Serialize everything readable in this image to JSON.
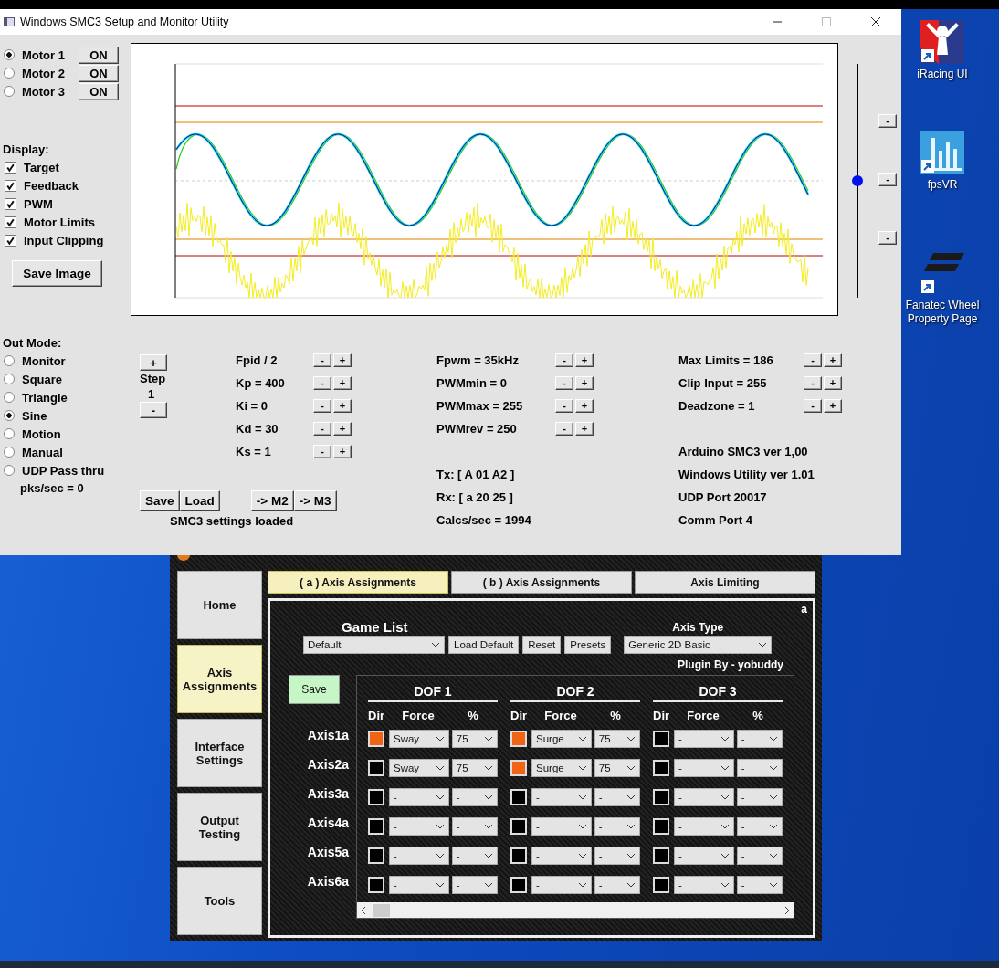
{
  "smc3_window": {
    "title": "Windows SMC3 Setup and Monitor Utility",
    "motors": [
      {
        "label": "Motor 1",
        "selected": true,
        "button": "ON"
      },
      {
        "label": "Motor 2",
        "selected": false,
        "button": "ON"
      },
      {
        "label": "Motor 3",
        "selected": false,
        "button": "ON"
      }
    ],
    "display": {
      "label": "Display:",
      "options": [
        {
          "label": "Target",
          "checked": true
        },
        {
          "label": "Feedback",
          "checked": true
        },
        {
          "label": "PWM",
          "checked": true
        },
        {
          "label": "Motor Limits",
          "checked": true
        },
        {
          "label": "Input Clipping",
          "checked": true
        }
      ]
    },
    "save_image": "Save Image",
    "graph_slider": {
      "level": 0.5
    },
    "side_buttons": [
      "-",
      "-",
      "-"
    ],
    "out_mode": {
      "label": "Out Mode:",
      "options": [
        {
          "label": "Monitor",
          "selected": false
        },
        {
          "label": "Square",
          "selected": false
        },
        {
          "label": "Triangle",
          "selected": false
        },
        {
          "label": "Sine",
          "selected": true
        },
        {
          "label": "Motion",
          "selected": false
        },
        {
          "label": "Manual",
          "selected": false
        },
        {
          "label": "UDP Pass thru",
          "selected": false
        }
      ],
      "rate": "pks/sec = 0"
    },
    "step": {
      "plus": "+",
      "label": "Step",
      "value": "1",
      "minus": "-"
    },
    "pid": [
      {
        "label": "Fpid / 2",
        "minus": "-",
        "plus": "+"
      },
      {
        "label": "Kp = 400",
        "minus": "-",
        "plus": "+"
      },
      {
        "label": "Ki = 0",
        "minus": "-",
        "plus": "+"
      },
      {
        "label": "Kd = 30",
        "minus": "-",
        "plus": "+"
      },
      {
        "label": "Ks = 1",
        "minus": "-",
        "plus": "+"
      }
    ],
    "pwm": [
      {
        "label": "Fpwm = 35kHz",
        "minus": "-",
        "plus": "+"
      },
      {
        "label": "PWMmin = 0",
        "minus": "-",
        "plus": "+"
      },
      {
        "label": "PWMmax = 255",
        "minus": "-",
        "plus": "+"
      },
      {
        "label": "PWMrev = 250",
        "minus": "-",
        "plus": "+"
      }
    ],
    "comms": [
      "Tx: [ A 01 A2 ]",
      "Rx: [ a 20 25 ]",
      "Calcs/sec = 1994"
    ],
    "limits": [
      {
        "label": "Max Limits = 186",
        "minus": "-",
        "plus": "+"
      },
      {
        "label": "Clip Input = 255",
        "minus": "-",
        "plus": "+"
      },
      {
        "label": "Deadzone = 1",
        "minus": "-",
        "plus": "+"
      }
    ],
    "info": [
      "Arduino SMC3 ver 1,00",
      "Windows Utility ver 1.01",
      "UDP Port 20017",
      "Comm Port 4"
    ],
    "file_buttons": [
      "Save",
      "Load"
    ],
    "copy_buttons": [
      "-> M2",
      "-> M3"
    ],
    "status": "SMC3 settings loaded"
  },
  "simtools_window": {
    "sidebar": [
      {
        "label": "Home",
        "selected": false
      },
      {
        "label": "Axis Assignments",
        "selected": true
      },
      {
        "label": "Interface Settings",
        "selected": false
      },
      {
        "label": "Output Testing",
        "selected": false
      },
      {
        "label": "Tools",
        "selected": false
      }
    ],
    "tabs": [
      {
        "label": "( a ) Axis Assignments",
        "selected": true
      },
      {
        "label": "( b ) Axis Assignments",
        "selected": false
      },
      {
        "label": "Axis Limiting",
        "selected": false
      }
    ],
    "corner_label": "a",
    "game_list": {
      "label": "Game List",
      "value": "Default",
      "buttons": [
        "Load Default",
        "Reset",
        "Presets"
      ]
    },
    "axis_type": {
      "label": "Axis Type",
      "value": "Generic 2D Basic"
    },
    "plugin_by": "Plugin By - yobuddy",
    "save": "Save",
    "dofs": [
      {
        "title": "DOF 1",
        "dir": "Dir",
        "force": "Force",
        "percent": "%"
      },
      {
        "title": "DOF 2",
        "dir": "Dir",
        "force": "Force",
        "percent": "%"
      },
      {
        "title": "DOF 3",
        "dir": "Dir",
        "force": "Force",
        "percent": "%"
      }
    ],
    "axes": [
      {
        "label": "Axis1a",
        "cells": [
          {
            "dir": true,
            "force": "Sway",
            "percent": "75"
          },
          {
            "dir": true,
            "force": "Surge",
            "percent": "75"
          },
          {
            "dir": false,
            "force": "-",
            "percent": "-"
          }
        ]
      },
      {
        "label": "Axis2a",
        "cells": [
          {
            "dir": false,
            "force": "Sway",
            "percent": "75"
          },
          {
            "dir": true,
            "force": "Surge",
            "percent": "75"
          },
          {
            "dir": false,
            "force": "-",
            "percent": "-"
          }
        ]
      },
      {
        "label": "Axis3a",
        "cells": [
          {
            "dir": false,
            "force": "-",
            "percent": "-"
          },
          {
            "dir": false,
            "force": "-",
            "percent": "-"
          },
          {
            "dir": false,
            "force": "-",
            "percent": "-"
          }
        ]
      },
      {
        "label": "Axis4a",
        "cells": [
          {
            "dir": false,
            "force": "-",
            "percent": "-"
          },
          {
            "dir": false,
            "force": "-",
            "percent": "-"
          },
          {
            "dir": false,
            "force": "-",
            "percent": "-"
          }
        ]
      },
      {
        "label": "Axis5a",
        "cells": [
          {
            "dir": false,
            "force": "-",
            "percent": "-"
          },
          {
            "dir": false,
            "force": "-",
            "percent": "-"
          },
          {
            "dir": false,
            "force": "-",
            "percent": "-"
          }
        ]
      },
      {
        "label": "Axis6a",
        "cells": [
          {
            "dir": false,
            "force": "-",
            "percent": "-"
          },
          {
            "dir": false,
            "force": "-",
            "percent": "-"
          },
          {
            "dir": false,
            "force": "-",
            "percent": "-"
          }
        ]
      }
    ]
  },
  "desktop_icons": [
    {
      "kind": "iracing",
      "label": "iRacing UI"
    },
    {
      "kind": "fpsvr",
      "label": "fpsVR"
    },
    {
      "kind": "fanatec",
      "label": "Fanatec Wheel Property Page"
    }
  ]
}
